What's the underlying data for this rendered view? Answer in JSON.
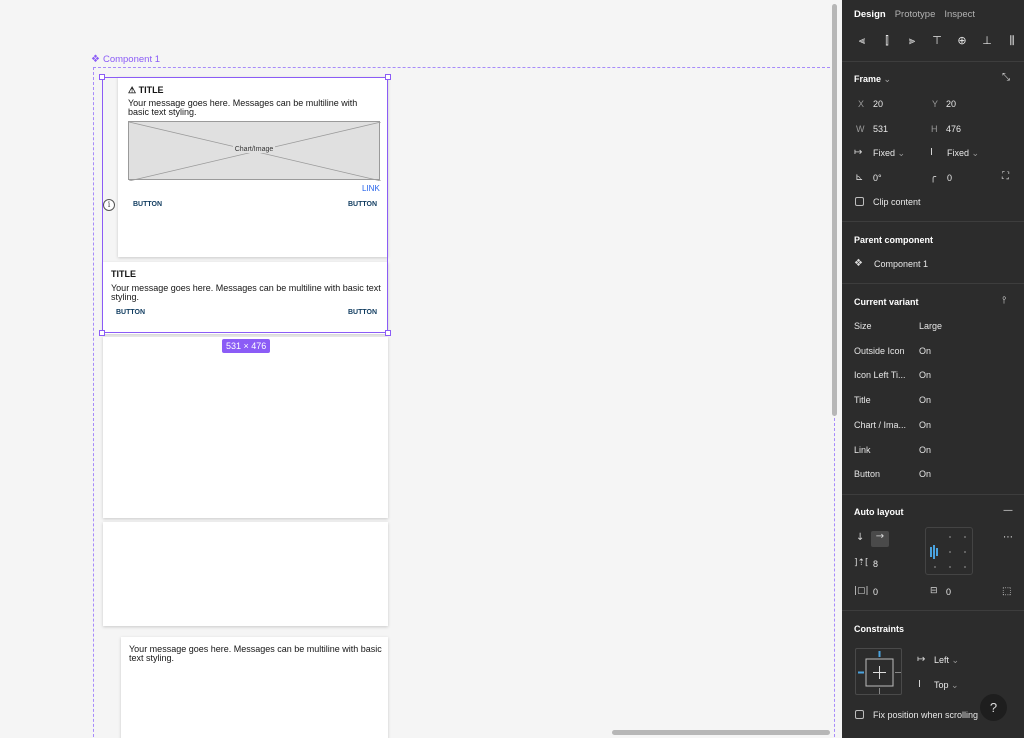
{
  "canvas": {
    "component_label": "Component 1",
    "size_badge": "531 × 476",
    "card1": {
      "title": "⚠ TITLE",
      "message": "Your message goes here. Messages can be multiline with basic text styling.",
      "image_label": "Chart/Image",
      "link": "LINK",
      "button_left": "BUTTON",
      "button_right": "BUTTON"
    },
    "card2": {
      "title": "TITLE",
      "message": "Your message goes here. Messages can be multiline with basic text styling.",
      "button_left": "BUTTON",
      "button_right": "BUTTON"
    },
    "card5": {
      "message": "Your message goes here. Messages can be multiline with basic text styling."
    },
    "info_glyph": "i"
  },
  "panel": {
    "tabs": [
      "Design",
      "Prototype",
      "Inspect"
    ],
    "frame": {
      "title": "Frame",
      "x_label": "X",
      "x": "20",
      "y_label": "Y",
      "y": "20",
      "w_label": "W",
      "w": "531",
      "h_label": "H",
      "h": "476",
      "h_resize": "Fixed",
      "v_resize": "Fixed",
      "rotation": "0°",
      "radius": "0",
      "clip_content": "Clip content"
    },
    "parent_component": {
      "title": "Parent component",
      "name": "Component 1"
    },
    "current_variant": {
      "title": "Current variant",
      "rows": [
        {
          "k": "Size",
          "v": "Large"
        },
        {
          "k": "Outside Icon",
          "v": "On"
        },
        {
          "k": "Icon Left Ti...",
          "v": "On"
        },
        {
          "k": "Title",
          "v": "On"
        },
        {
          "k": "Chart / Ima...",
          "v": "On"
        },
        {
          "k": "Link",
          "v": "On"
        },
        {
          "k": "Button",
          "v": "On"
        }
      ]
    },
    "auto_layout": {
      "title": "Auto layout",
      "spacing": "8",
      "padding_h": "0",
      "padding_v": "0"
    },
    "constraints": {
      "title": "Constraints",
      "horizontal": "Left",
      "vertical": "Top",
      "fix_position": "Fix position when scrolling"
    },
    "help": "?"
  },
  "colors": {
    "accent": "#8b5cf6",
    "panel_bg": "#2c2c2c",
    "canvas_bg": "#f5f5f5",
    "button_text": "#0f3b5f",
    "link": "#2563eb"
  }
}
